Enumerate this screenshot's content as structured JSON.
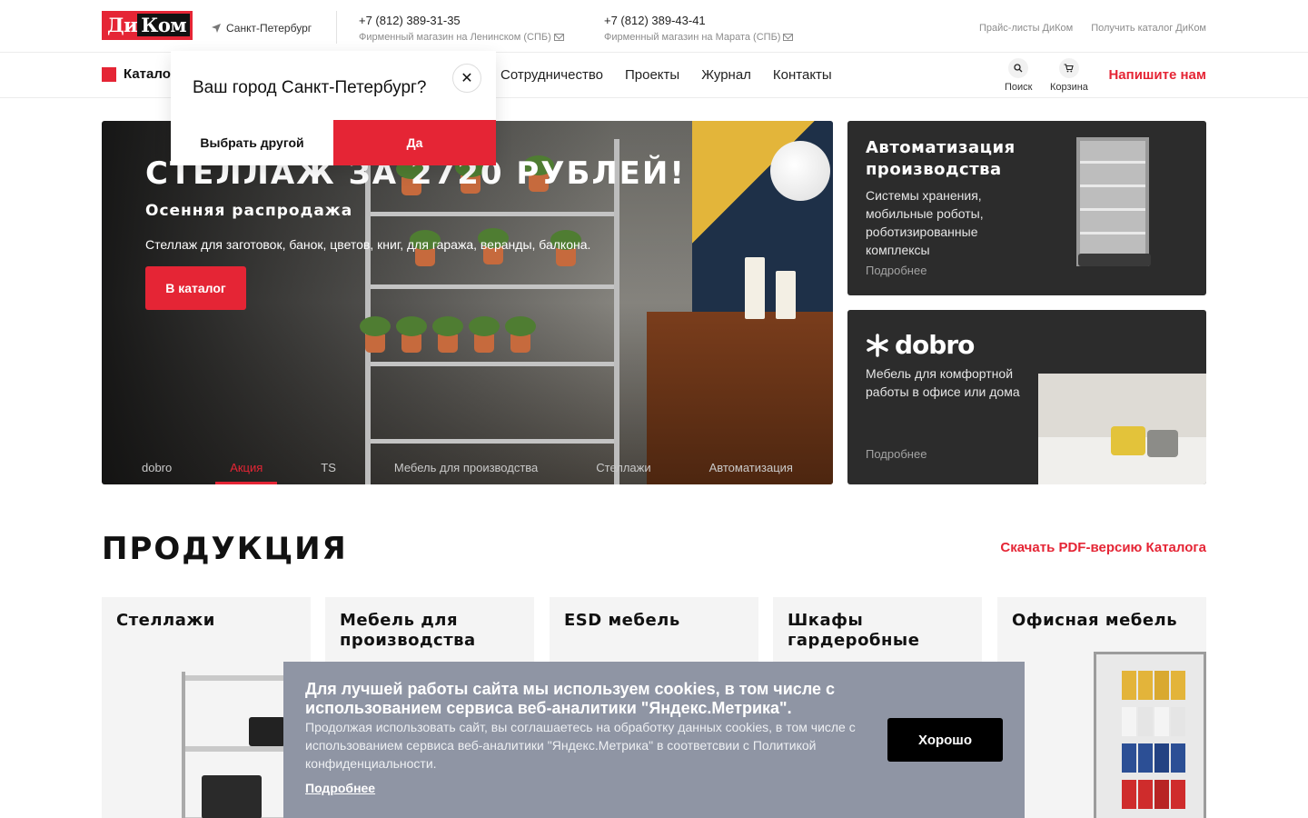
{
  "header": {
    "logo_text": "Ди",
    "logo_text_2": "Ком",
    "city": "Санкт-Петербург",
    "phones": [
      {
        "number": "+7 (812) 389-31-35",
        "shop": "Фирменный магазин на Ленинском (СПБ)"
      },
      {
        "number": "+7 (812) 389-43-41",
        "shop": "Фирменный магазин на Марата (СПБ)"
      }
    ],
    "links": [
      "Прайс-листы ДиКом",
      "Получить каталог ДиКом"
    ]
  },
  "nav": {
    "catalog": "Катало",
    "items": [
      "Сотрудничество",
      "Проекты",
      "Журнал",
      "Контакты"
    ],
    "search": "Поиск",
    "cart": "Корзина",
    "write_us": "Напишите нам"
  },
  "city_popup": {
    "question": "Ваш город Санкт-Петербург?",
    "other": "Выбрать другой",
    "yes": "Да"
  },
  "hero": {
    "title": "СТЕЛЛАЖ ЗА 2720 РУБЛЕЙ!",
    "subtitle": "Осенняя распродажа",
    "text": "Стеллаж для заготовок, банок, цветов, книг, для гаража, веранды, балкона.",
    "cta": "В каталог",
    "tabs": [
      "dobro",
      "Акция",
      "TS",
      "Мебель для производства",
      "Стеллажи",
      "Автоматизация"
    ],
    "active_tab": "Акция"
  },
  "side_cards": [
    {
      "title": "Автоматизация производства",
      "desc": "Системы хранения, мобильные роботы, роботизированные комплексы",
      "more": "Подробнее"
    },
    {
      "logo": "dobro",
      "desc": "Мебель для комфортной работы в офисе или дома",
      "more": "Подробнее"
    }
  ],
  "products": {
    "title": "ПРОДУКЦИЯ",
    "pdf": "Скачать PDF-версию Каталога",
    "cards": [
      "Стеллажи",
      "Мебель для производства",
      "ESD мебель",
      "Шкафы гардеробные",
      "Офисная мебель"
    ]
  },
  "cookie": {
    "title": "Для лучшей работы сайта мы используем cookies, в том числе с использованием сервиса веб-аналитики \"Яндекс.Метрика\".",
    "desc": "Продолжая использовать сайт, вы соглашаетесь на обработку данных cookies, в том числе с использованием сервиса веб-аналитики \"Яндекс.Метрика\" в соответсвии с Политикой конфиденциальности.",
    "more": "Подробнее",
    "ok": "Хорошо"
  },
  "colors": {
    "accent": "#e52535",
    "dark_card": "#2c2c2c",
    "cookie_bg": "#8f95a4"
  }
}
